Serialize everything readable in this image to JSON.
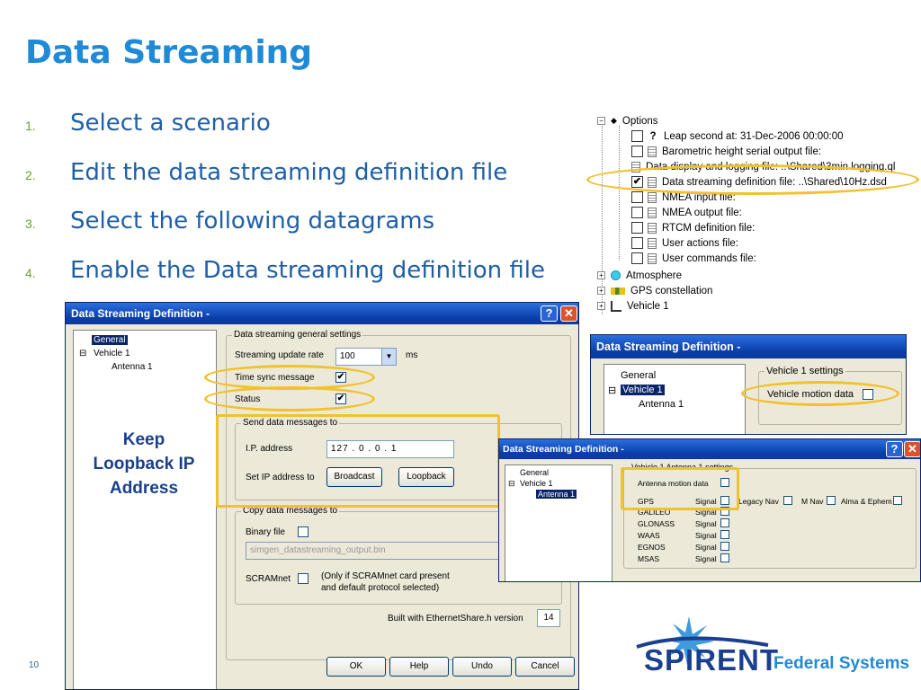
{
  "slide": {
    "title": "Data Streaming",
    "page_number": "10",
    "steps": [
      {
        "num": "1.",
        "text": "Select a scenario"
      },
      {
        "num": "2.",
        "text": "Edit the data streaming definition file"
      },
      {
        "num": "3.",
        "text": "Select the following datagrams"
      },
      {
        "num": "4.",
        "text": "Enable the Data streaming definition file"
      }
    ],
    "callout": "Keep Loopback IP Address"
  },
  "options_tree": {
    "root": "Options",
    "items": [
      {
        "icon": "question-icon",
        "checked": false,
        "text": "Leap second at: 31-Dec-2006 00:00:00"
      },
      {
        "icon": "document-icon",
        "checked": false,
        "text": "Barometric height serial output file:"
      },
      {
        "icon": "document-icon",
        "checked": null,
        "text": "Data display and logging file: ..\\Shared\\3min logging.ql"
      },
      {
        "icon": "document-icon",
        "checked": true,
        "text": "Data streaming definition file: ..\\Shared\\10Hz.dsd"
      },
      {
        "icon": "document-icon",
        "checked": false,
        "text": "NMEA input file:"
      },
      {
        "icon": "document-icon",
        "checked": false,
        "text": "NMEA output file:"
      },
      {
        "icon": "document-icon",
        "checked": false,
        "text": "RTCM definition file:"
      },
      {
        "icon": "document-icon",
        "checked": false,
        "text": "User actions file:"
      },
      {
        "icon": "document-icon",
        "checked": false,
        "text": "User commands file:"
      }
    ],
    "nodes": [
      "Atmosphere",
      "GPS constellation",
      "Vehicle 1"
    ]
  },
  "dialog_main": {
    "title": "Data Streaming Definition -",
    "tree": [
      "General",
      "Vehicle 1",
      "Antenna 1"
    ],
    "general_group": "Data streaming general settings",
    "update_rate_label": "Streaming update rate",
    "update_rate_value": "100",
    "update_rate_unit": "ms",
    "time_sync_label": "Time sync message",
    "time_sync_checked": true,
    "status_label": "Status",
    "status_checked": true,
    "send_group": "Send data messages to",
    "ip_label": "I.P. address",
    "ip_parts": [
      "127",
      "0",
      "0",
      "1"
    ],
    "set_ip_label": "Set IP address to",
    "broadcast_button": "Broadcast",
    "loopback_button": "Loopback",
    "copy_group": "Copy data messages to",
    "binary_label": "Binary file",
    "binary_file": "simgen_datastreaming_output.bin",
    "scramnet_label": "SCRAMnet",
    "scramnet_note_1": "(Only if SCRAMnet card present",
    "scramnet_note_2": "and default protocol selected)",
    "built_with_label": "Built with EthernetShare.h version",
    "version": "14",
    "ok_button": "OK",
    "help_button": "Help",
    "undo_button": "Undo",
    "cancel_button": "Cancel"
  },
  "dialog_vehicle": {
    "title": "Data Streaming Definition -",
    "tree": [
      "General",
      "Vehicle 1",
      "Antenna 1"
    ],
    "group": "Vehicle 1 settings",
    "motion_label": "Vehicle motion data"
  },
  "dialog_antenna": {
    "title": "Data Streaming Definition -",
    "tree": [
      "General",
      "Vehicle 1",
      "Antenna 1"
    ],
    "group": "Vehicle 1 Antenna 1 settings",
    "motion_label": "Antenna motion data",
    "signal_word": "Signal",
    "legacy_nav": "Legacy Nav",
    "m_nav": "M Nav",
    "alma": "Alma & Ephem",
    "systems": [
      "GPS",
      "GALILEO",
      "GLONASS",
      "WAAS",
      "EGNOS",
      "MSAS"
    ]
  },
  "logo": {
    "word": "SPIRENT",
    "sub": "Federal Systems",
    "colors": {
      "navy": "#1b3f8f",
      "blue": "#1f8ad6"
    }
  },
  "colors": {
    "title": "#1f8ad6",
    "step_text": "#1f5fa6",
    "step_num": "#6aa22c",
    "highlight": "#f2c12e"
  }
}
